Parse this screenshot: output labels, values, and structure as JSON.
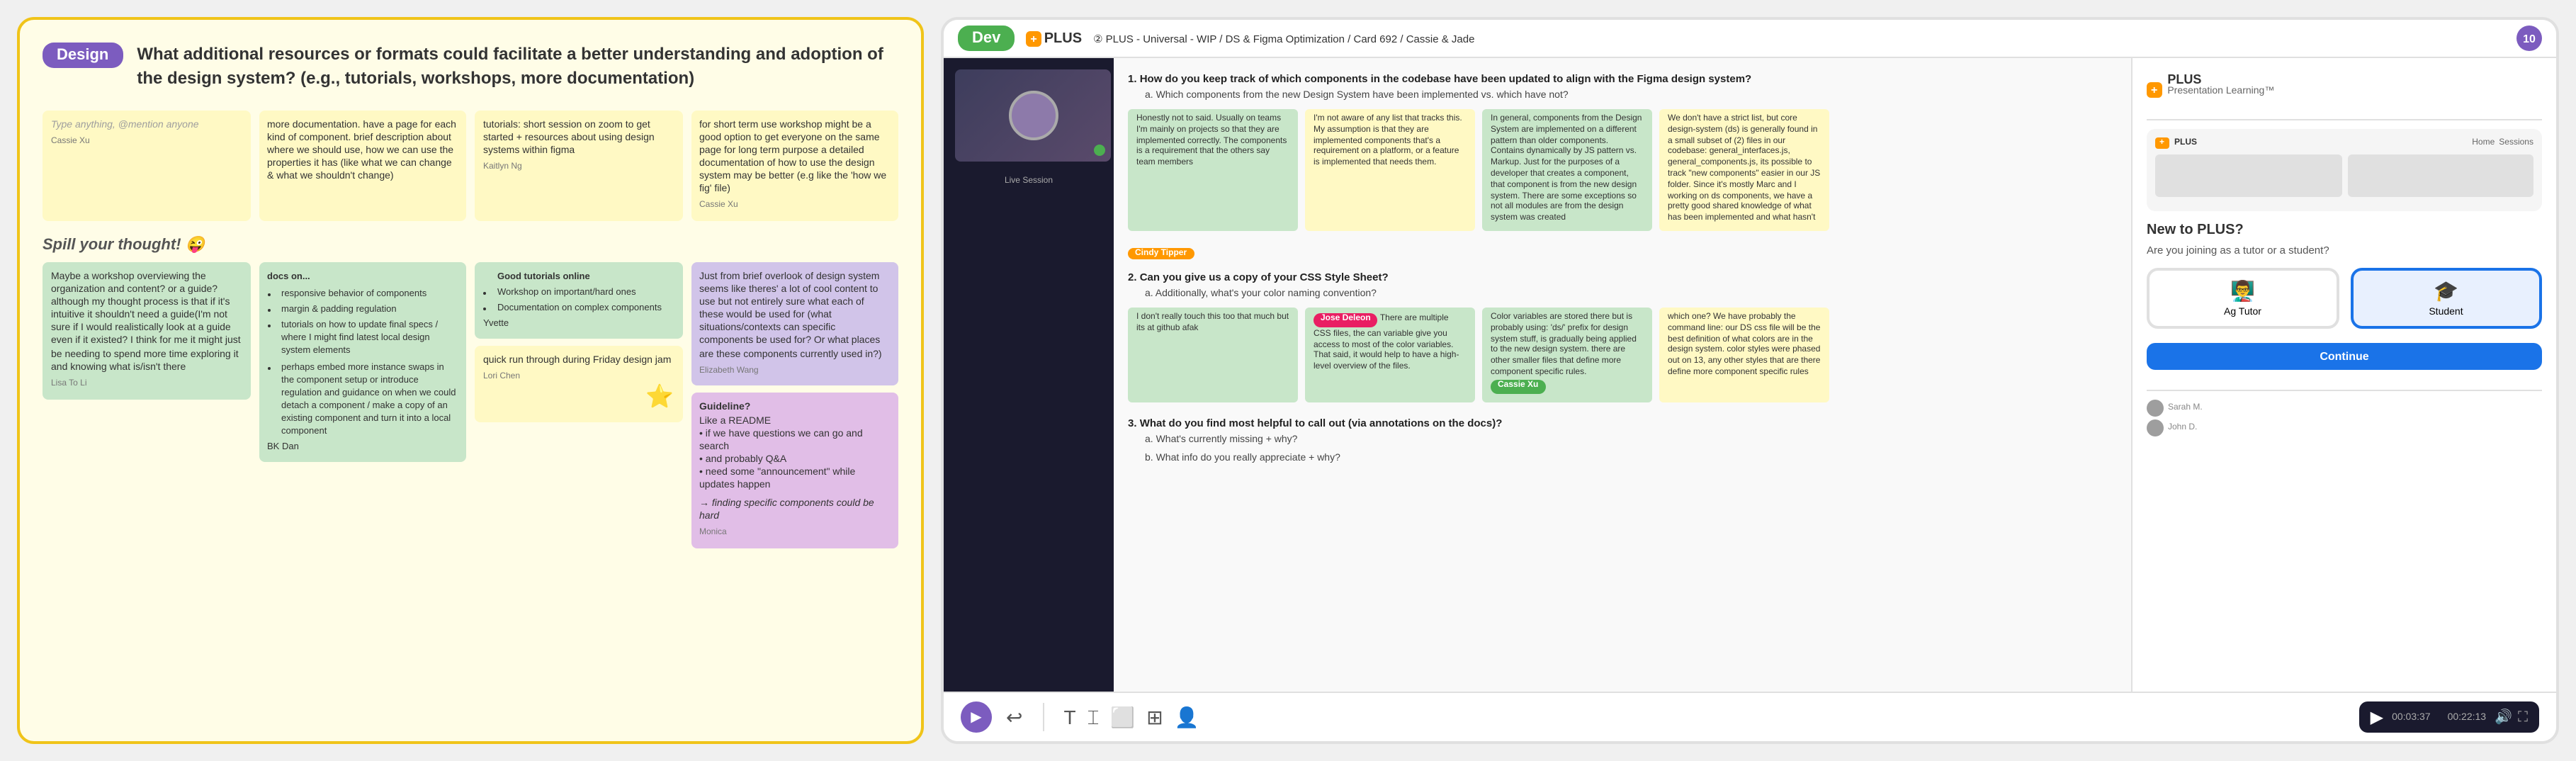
{
  "left_panel": {
    "badge": "Design",
    "question": "What additional resources or formats could facilitate a better understanding and adoption of the design system? (e.g., tutorials, workshops, more documentation)",
    "section_label": "Spill your thought! 😜",
    "top_stickies": [
      {
        "text": "Type anything, @mention anyone",
        "color": "sticky-yellow",
        "author": "Cassie Xu"
      },
      {
        "text": "more documentation. have a page for each kind of component. brief description about where we should use, how we can use the properties it has (like what we can change & what we shouldn't change)",
        "color": "sticky-yellow",
        "author": ""
      },
      {
        "text": "tutorials: short session on zoom to get started + resources about using design systems within figma",
        "color": "sticky-yellow",
        "author": "Kaitlyn Ng"
      },
      {
        "text": "for short term use workshop might be a good option to get everyone on the same page\nfor long term purpose a detailed documentation of how to use the design system may be better (e.g like the 'how we fig' file)",
        "color": "sticky-yellow",
        "author": "Cassie Xu"
      }
    ],
    "bottom_col1": {
      "text": "Maybe a workshop overviewing the organization and content? or a guide? although my thought process is that if it's intuitive it shouldn't need a guide(I'm not sure if I would realistically look at a guide even if it existed? I think for me it might just be needing to spend more time exploring it and knowing what is/isn't there",
      "color": "sticky-green",
      "author": "Lisa To Li"
    },
    "bottom_col2_title": "docs on...",
    "bottom_col2_items": [
      "responsive behavior of components",
      "margin & padding regulation",
      "tutorials on how to update final specs / where I might find latest local design system elements",
      "perhaps embed more instance swaps in the component setup or introduce regulation and guidance on when we could detach a component / make a copy of an existing component and turn it into a local component"
    ],
    "bottom_col2_author": "BK Dan",
    "bottom_col3_title": "Good tutorials online",
    "bottom_col3_items": [
      "Workshop on important/hard ones",
      "Documentation on complex components"
    ],
    "bottom_col3_author": "Yvette",
    "bottom_col3_b": "quick run through during Friday design jam",
    "bottom_col3_b_author": "Lori Chen",
    "bottom_col4_intro": "Just from brief overlook of design system seems like theres' a lot of cool content to use but not entirely sure what each of these would be used for (what situations/contexts can specific components be used for? Or what places are these components currently used in?)",
    "bottom_col4_author": "Elizabeth Wang",
    "bottom_col5_title": "Guideline?",
    "bottom_col5_text": "Like a README\n• if we have questions we can go and search\n• and probably Q&A\n• need some \"announcement\" while updates happen",
    "bottom_col5_author": "Monica",
    "bottom_col5_extra": "→ finding specific components could be hard"
  },
  "right_panel": {
    "badge": "Dev",
    "topbar": {
      "logo": "PLUS",
      "logo_sub": "Presentation Learning™",
      "breadcrumb": "② PLUS - Universal - WIP / DS & Figma Optimization / Card 692 / Cassie & Jade",
      "user_count": "10"
    },
    "questions": [
      {
        "number": "1.",
        "text": "How do you keep track of which components in the codebase have been updated to align with the Figma design system?",
        "sub": "a. Which components from the new Design System have been implemented vs. which have not?"
      },
      {
        "number": "2.",
        "text": "Can you give us a copy of your CSS Style Sheet?",
        "sub": "a. Additionally, what's your color naming convention?"
      },
      {
        "number": "3.",
        "text": "What do you find most helpful to call out (via annotations on the docs)?",
        "sub_a": "a. What's currently missing + why?",
        "sub_b": "b. What info do you really appreciate + why?"
      }
    ],
    "name_tags": [
      "Cindy Tipper",
      "Jose Deleon",
      "Cassie Xu"
    ],
    "sidebar": {
      "logo": "PLUS",
      "title": "Presentation Learning™",
      "new_to_plus": "New to PLUS?",
      "join_question": "Are you joining as a tutor or a student?",
      "roles": [
        "Ag Tutor",
        "Student"
      ],
      "continue_btn": "Continue"
    },
    "video": {
      "time_current": "00:03:37",
      "time_total": "00:22:13"
    }
  }
}
